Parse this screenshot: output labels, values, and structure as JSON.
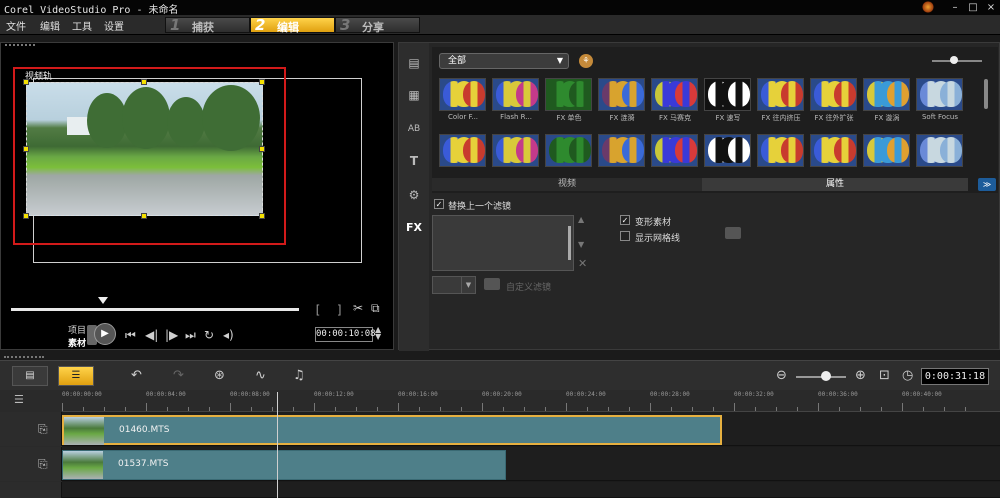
{
  "window": {
    "title": "Corel VideoStudio Pro - 未命名",
    "min": "–",
    "max": "□",
    "close": "×"
  },
  "menu": [
    "文件",
    "编辑",
    "工具",
    "设置"
  ],
  "steps": [
    {
      "num": "1",
      "label": "捕获"
    },
    {
      "num": "2",
      "label": "编辑"
    },
    {
      "num": "3",
      "label": "分享"
    }
  ],
  "preview": {
    "track_label": "视频轨",
    "mode_project": "项目",
    "mode_clip": "素材",
    "timecode": "00:00:10:08"
  },
  "library": {
    "category": "全部",
    "items": [
      "Color F...",
      "Flash R...",
      "FX 单色",
      "FX 涟漪",
      "FX 马赛克",
      "FX 速写",
      "FX 往内挤压",
      "FX 往外扩张",
      "FX 漩涡",
      "Soft Focus",
      "",
      "",
      "",
      "",
      "",
      "",
      "",
      "",
      "",
      ""
    ],
    "tab_video": "视频",
    "tab_attributes": "属性",
    "fx_tab": "FX"
  },
  "attributes": {
    "replace_last_filter": "替换上一个滤镜",
    "distort_clip": "变形素材",
    "show_grid": "显示网格线",
    "custom_filter": "自定义滤镜"
  },
  "timeline": {
    "timecode": "0:00:31:18",
    "ruler": [
      "00:00:00:00",
      "00:00:04:00",
      "00:00:08:00",
      "00:00:12:00",
      "00:00:16:00",
      "00:00:20:00",
      "00:00:24:00",
      "00:00:28:00",
      "00:00:32:00",
      "00:00:36:00",
      "00:00:40:00"
    ],
    "clips": [
      {
        "name": "01460.MTS"
      },
      {
        "name": "01537.MTS"
      }
    ]
  },
  "colors": {
    "accent": "#f0b020",
    "selection_frame": "#d21a1a",
    "clip": "#4e7f89"
  }
}
